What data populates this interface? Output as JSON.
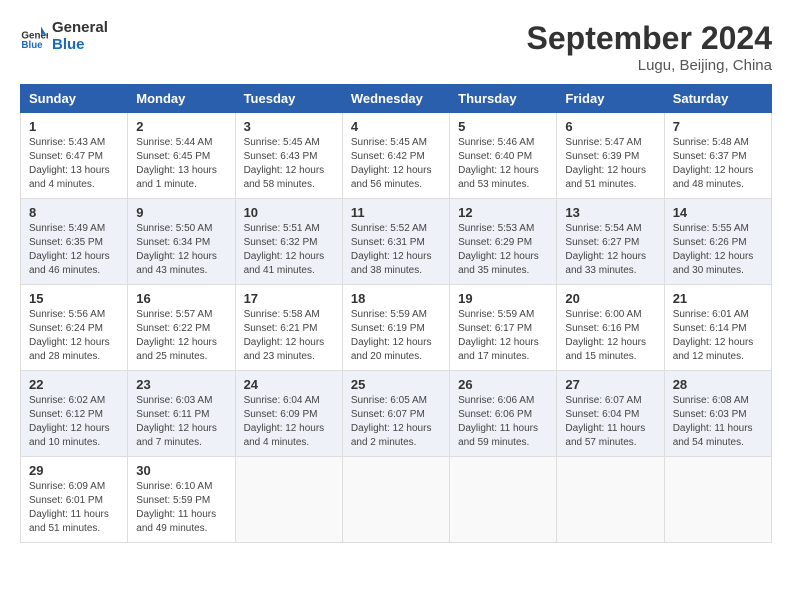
{
  "app": {
    "logo_line1": "General",
    "logo_line2": "Blue"
  },
  "title": "September 2024",
  "location": "Lugu, Beijing, China",
  "weekdays": [
    "Sunday",
    "Monday",
    "Tuesday",
    "Wednesday",
    "Thursday",
    "Friday",
    "Saturday"
  ],
  "weeks": [
    [
      {
        "day": "1",
        "sunrise": "5:43 AM",
        "sunset": "6:47 PM",
        "daylight": "13 hours and 4 minutes."
      },
      {
        "day": "2",
        "sunrise": "5:44 AM",
        "sunset": "6:45 PM",
        "daylight": "13 hours and 1 minute."
      },
      {
        "day": "3",
        "sunrise": "5:45 AM",
        "sunset": "6:43 PM",
        "daylight": "12 hours and 58 minutes."
      },
      {
        "day": "4",
        "sunrise": "5:45 AM",
        "sunset": "6:42 PM",
        "daylight": "12 hours and 56 minutes."
      },
      {
        "day": "5",
        "sunrise": "5:46 AM",
        "sunset": "6:40 PM",
        "daylight": "12 hours and 53 minutes."
      },
      {
        "day": "6",
        "sunrise": "5:47 AM",
        "sunset": "6:39 PM",
        "daylight": "12 hours and 51 minutes."
      },
      {
        "day": "7",
        "sunrise": "5:48 AM",
        "sunset": "6:37 PM",
        "daylight": "12 hours and 48 minutes."
      }
    ],
    [
      {
        "day": "8",
        "sunrise": "5:49 AM",
        "sunset": "6:35 PM",
        "daylight": "12 hours and 46 minutes."
      },
      {
        "day": "9",
        "sunrise": "5:50 AM",
        "sunset": "6:34 PM",
        "daylight": "12 hours and 43 minutes."
      },
      {
        "day": "10",
        "sunrise": "5:51 AM",
        "sunset": "6:32 PM",
        "daylight": "12 hours and 41 minutes."
      },
      {
        "day": "11",
        "sunrise": "5:52 AM",
        "sunset": "6:31 PM",
        "daylight": "12 hours and 38 minutes."
      },
      {
        "day": "12",
        "sunrise": "5:53 AM",
        "sunset": "6:29 PM",
        "daylight": "12 hours and 35 minutes."
      },
      {
        "day": "13",
        "sunrise": "5:54 AM",
        "sunset": "6:27 PM",
        "daylight": "12 hours and 33 minutes."
      },
      {
        "day": "14",
        "sunrise": "5:55 AM",
        "sunset": "6:26 PM",
        "daylight": "12 hours and 30 minutes."
      }
    ],
    [
      {
        "day": "15",
        "sunrise": "5:56 AM",
        "sunset": "6:24 PM",
        "daylight": "12 hours and 28 minutes."
      },
      {
        "day": "16",
        "sunrise": "5:57 AM",
        "sunset": "6:22 PM",
        "daylight": "12 hours and 25 minutes."
      },
      {
        "day": "17",
        "sunrise": "5:58 AM",
        "sunset": "6:21 PM",
        "daylight": "12 hours and 23 minutes."
      },
      {
        "day": "18",
        "sunrise": "5:59 AM",
        "sunset": "6:19 PM",
        "daylight": "12 hours and 20 minutes."
      },
      {
        "day": "19",
        "sunrise": "5:59 AM",
        "sunset": "6:17 PM",
        "daylight": "12 hours and 17 minutes."
      },
      {
        "day": "20",
        "sunrise": "6:00 AM",
        "sunset": "6:16 PM",
        "daylight": "12 hours and 15 minutes."
      },
      {
        "day": "21",
        "sunrise": "6:01 AM",
        "sunset": "6:14 PM",
        "daylight": "12 hours and 12 minutes."
      }
    ],
    [
      {
        "day": "22",
        "sunrise": "6:02 AM",
        "sunset": "6:12 PM",
        "daylight": "12 hours and 10 minutes."
      },
      {
        "day": "23",
        "sunrise": "6:03 AM",
        "sunset": "6:11 PM",
        "daylight": "12 hours and 7 minutes."
      },
      {
        "day": "24",
        "sunrise": "6:04 AM",
        "sunset": "6:09 PM",
        "daylight": "12 hours and 4 minutes."
      },
      {
        "day": "25",
        "sunrise": "6:05 AM",
        "sunset": "6:07 PM",
        "daylight": "12 hours and 2 minutes."
      },
      {
        "day": "26",
        "sunrise": "6:06 AM",
        "sunset": "6:06 PM",
        "daylight": "11 hours and 59 minutes."
      },
      {
        "day": "27",
        "sunrise": "6:07 AM",
        "sunset": "6:04 PM",
        "daylight": "11 hours and 57 minutes."
      },
      {
        "day": "28",
        "sunrise": "6:08 AM",
        "sunset": "6:03 PM",
        "daylight": "11 hours and 54 minutes."
      }
    ],
    [
      {
        "day": "29",
        "sunrise": "6:09 AM",
        "sunset": "6:01 PM",
        "daylight": "11 hours and 51 minutes."
      },
      {
        "day": "30",
        "sunrise": "6:10 AM",
        "sunset": "5:59 PM",
        "daylight": "11 hours and 49 minutes."
      },
      null,
      null,
      null,
      null,
      null
    ]
  ]
}
